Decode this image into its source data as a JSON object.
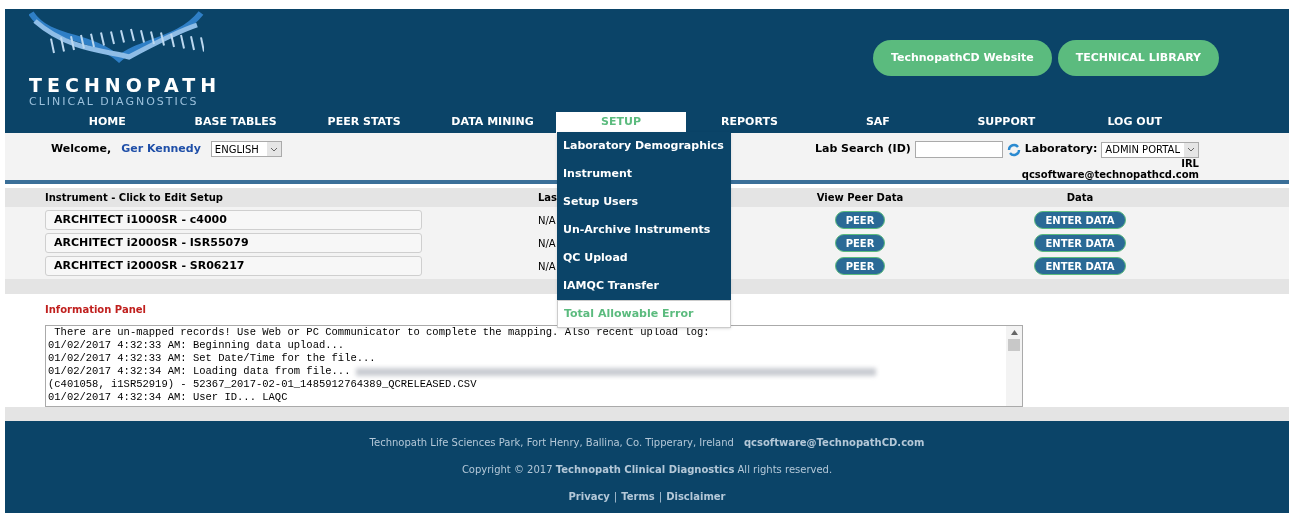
{
  "logo": {
    "name": "TECHNOPATH",
    "tagline": "CLINICAL DIAGNOSTICS"
  },
  "header_links": [
    "TechnopathCD Website",
    "TECHNICAL LIBRARY"
  ],
  "nav": [
    {
      "label": "HOME",
      "selected": false
    },
    {
      "label": "BASE TABLES",
      "selected": false
    },
    {
      "label": "PEER STATS",
      "selected": false
    },
    {
      "label": "DATA MINING",
      "selected": false
    },
    {
      "label": "SETUP",
      "selected": true
    },
    {
      "label": "REPORTS",
      "selected": false
    },
    {
      "label": "SAF",
      "selected": false
    },
    {
      "label": "SUPPORT",
      "selected": false
    },
    {
      "label": "LOG OUT",
      "selected": false
    }
  ],
  "setup_menu": [
    {
      "label": "Laboratory Demographics",
      "selected": false
    },
    {
      "label": "Instrument",
      "selected": false
    },
    {
      "label": "Setup Users",
      "selected": false
    },
    {
      "label": "Un-Archive Instruments",
      "selected": false
    },
    {
      "label": "QC Upload",
      "selected": false
    },
    {
      "label": "IAMQC Transfer",
      "selected": false
    },
    {
      "label": "Total Allowable Error",
      "selected": true
    }
  ],
  "welcome": {
    "label": "Welcome,",
    "user": "Ger Kennedy",
    "language": "ENGLISH"
  },
  "lab_search": {
    "label": "Lab Search (ID)",
    "laboratory_label": "Laboratory:",
    "laboratory": "ADMIN PORTAL",
    "lab_code": "IRL",
    "email": "qcsoftware@technopathcd.com"
  },
  "table": {
    "columns": [
      "Instrument - Click to Edit Setup",
      "Las",
      "View Peer Data",
      "Data"
    ],
    "rows": [
      {
        "instrument": "ARCHITECT i1000SR - c4000",
        "column_2": "N/A",
        "peer": "PEER",
        "data": "ENTER DATA"
      },
      {
        "instrument": "ARCHITECT i2000SR - ISR55079",
        "column_2": "N/A",
        "peer": "PEER",
        "data": "ENTER DATA"
      },
      {
        "instrument": "ARCHITECT i2000SR - SR06217",
        "column_2": "N/A",
        "peer": "PEER",
        "data": "ENTER DATA"
      }
    ]
  },
  "information_panel": {
    "title": "Information Panel",
    "log": [
      {
        "text": " There are un-mapped records! Use Web or PC Communicator to complete the mapping. Also recent upload log:",
        "redacted": false
      },
      {
        "text": "01/02/2017 4:32:33 AM: Beginning data upload...",
        "redacted": false
      },
      {
        "text": "01/02/2017 4:32:33 AM: Set Date/Time for the file...",
        "redacted": false
      },
      {
        "text": "01/02/2017 4:32:34 AM: Loading data from file...",
        "redacted": true
      },
      {
        "text": "(c401058, i1SR52919) - 52367_2017-02-01_1485912764389_QCRELEASED.CSV",
        "redacted": false
      },
      {
        "text": "01/02/2017 4:32:34 AM: User ID... LAQC",
        "redacted": false
      }
    ]
  },
  "footer": {
    "address": "Technopath Life Sciences Park, Fort Henry, Ballina, Co. Tipperary, Ireland",
    "email": "qcsoftware@TechnopathCD.com",
    "copyright": "Copyright © 2017 **Technopath Clinical Diagnostics** All rights reserved.",
    "links": [
      "Privacy",
      "Terms",
      "Disclaimer"
    ],
    "separator": "|"
  }
}
